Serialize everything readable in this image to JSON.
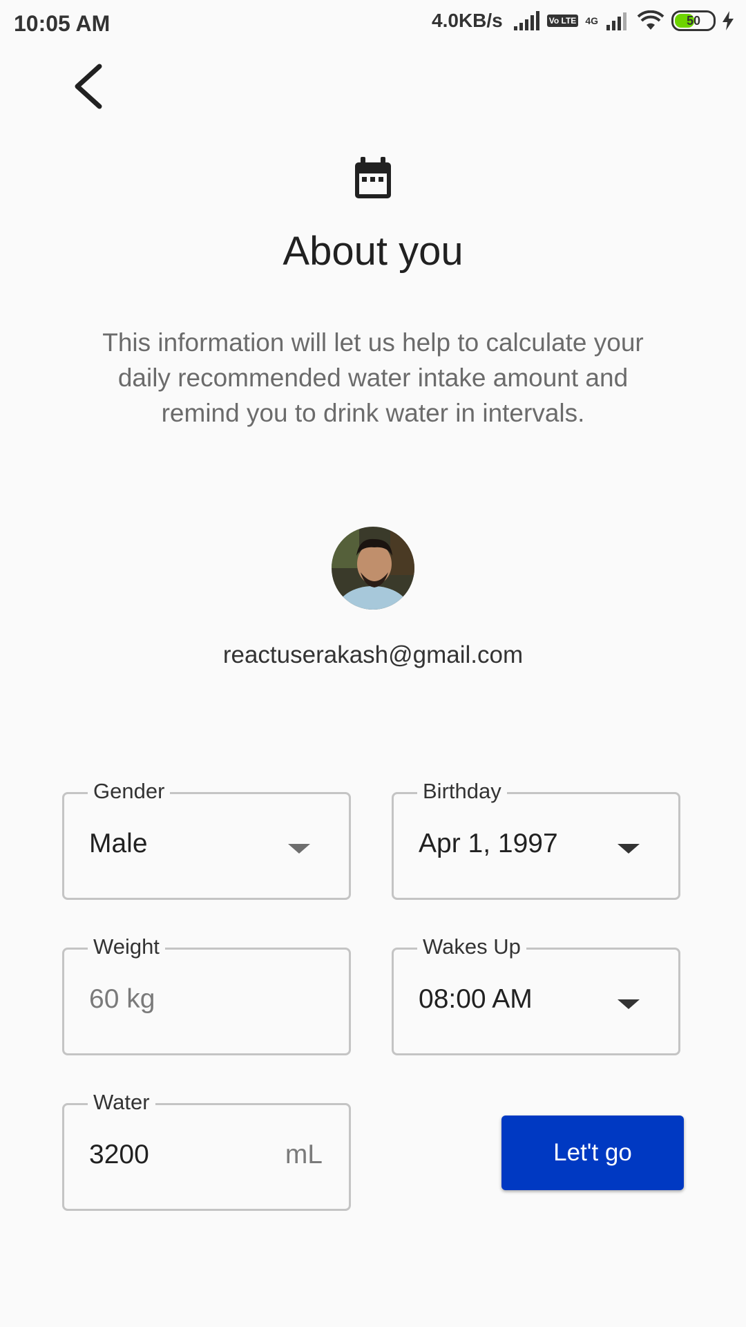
{
  "status_bar": {
    "time": "10:05 AM",
    "net_speed": "4.0KB/s",
    "network": "4G",
    "volte": "Vo LTE",
    "battery": "50"
  },
  "header": {
    "title": "About you",
    "description": "This information will let us help to calculate your daily recommended water intake amount and remind you to drink water in intervals."
  },
  "user": {
    "email": "reactuserakash@gmail.com"
  },
  "form": {
    "gender": {
      "label": "Gender",
      "value": "Male"
    },
    "birthday": {
      "label": "Birthday",
      "value": "Apr 1, 1997"
    },
    "weight": {
      "label": "Weight",
      "placeholder": "60 kg"
    },
    "wakes_up": {
      "label": "Wakes Up",
      "value": "08:00 AM"
    },
    "water": {
      "label": "Water",
      "value": "3200",
      "unit": "mL"
    },
    "submit_label": "Let't go"
  },
  "colors": {
    "accent": "#0039c2",
    "background": "#fafafa",
    "border": "#c4c4c4"
  }
}
